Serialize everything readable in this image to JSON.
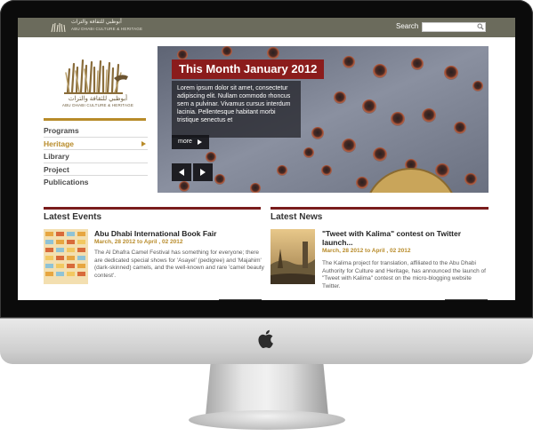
{
  "topbar": {
    "org_arabic": "أبوظبي للثقافة والتراث",
    "org_name": "ABU DHABI CULTURE & HERITAGE",
    "search_label": "Search",
    "search_value": ""
  },
  "logo": {
    "arabic": "أبوظبي للثقافة والتراث",
    "name": "ABU DHABI CULTURE & HERITAGE"
  },
  "nav": {
    "items": [
      {
        "label": "Programs"
      },
      {
        "label": "Heritage"
      },
      {
        "label": "Library"
      },
      {
        "label": "Project"
      },
      {
        "label": "Publications"
      }
    ]
  },
  "hero": {
    "title": "This Month January 2012",
    "text": "Lorem ipsum dolor sit amet, consectetur adipiscing elit. Nullam commodo rhoncus sem a pulvinar. Vivamus cursus interdum lacinia. Pellentesque habitant morbi tristique senectus et",
    "more_label": "more"
  },
  "events": {
    "heading": "Latest Events",
    "item": {
      "title": "Abu Dhabi International Book Fair",
      "date": "March, 28 2012 to April , 02 2012",
      "desc": "The Al Dhafra Camel Festival has something for everyone; there are dedicated special shows for 'Asayel' (pedigree) and 'Majahim' (dark-skinned) camels, and the well-known and rare 'camel beauty contest'."
    }
  },
  "news": {
    "heading": "Latest News",
    "item": {
      "title": "\"Tweet with Kalima\" contest on Twitter launch...",
      "date": "March, 28 2012 to April , 02 2012",
      "desc": "The Kalima project for translation, affiliated to the Abu Dhabi Authority for Culture and Heritage, has announced the launch of \"Tweet with Kalima\" contest on the micro-blogging website Twitter."
    }
  },
  "colors": {
    "topbar": "#6b6b5c",
    "accent_gold": "#b88b2a",
    "accent_red": "#8b1c1c"
  }
}
